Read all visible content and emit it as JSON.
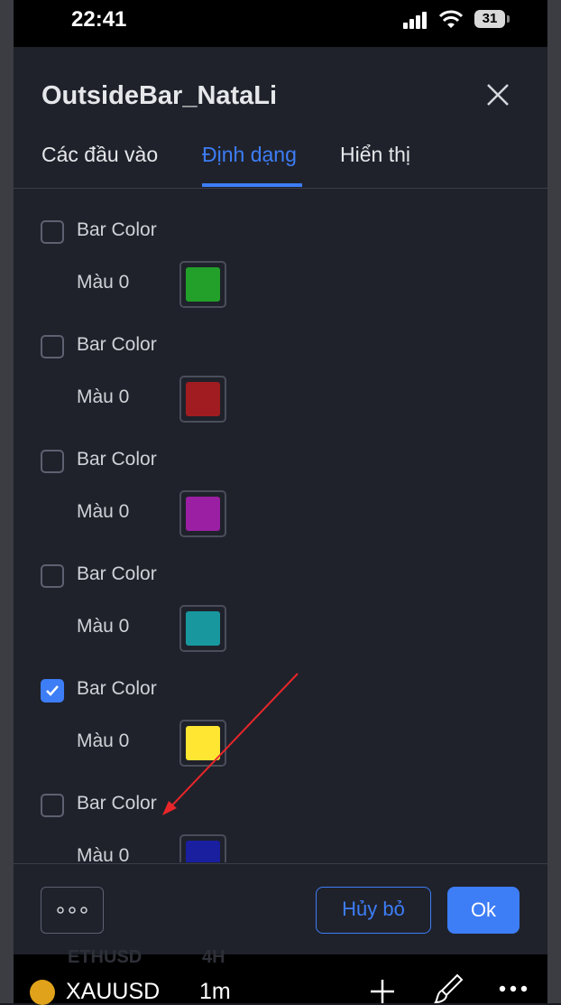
{
  "status_bar": {
    "time": "22:41",
    "battery": "31"
  },
  "dialog": {
    "title": "OutsideBar_NataLi",
    "tabs": [
      {
        "label": "Các đầu vào",
        "active": false
      },
      {
        "label": "Định dạng",
        "active": true
      },
      {
        "label": "Hiển thị",
        "active": false
      }
    ],
    "items": [
      {
        "checkbox_label": "Bar Color",
        "checked": false,
        "color_label": "Màu 0",
        "color": "#22a02a"
      },
      {
        "checkbox_label": "Bar Color",
        "checked": false,
        "color_label": "Màu 0",
        "color": "#a01c20"
      },
      {
        "checkbox_label": "Bar Color",
        "checked": false,
        "color_label": "Màu 0",
        "color": "#9a1fa3"
      },
      {
        "checkbox_label": "Bar Color",
        "checked": false,
        "color_label": "Màu 0",
        "color": "#18979e"
      },
      {
        "checkbox_label": "Bar Color",
        "checked": true,
        "color_label": "Màu 0",
        "color": "#ffe632"
      },
      {
        "checkbox_label": "Bar Color",
        "checked": false,
        "color_label": "Màu 0",
        "color": "#1a1fa0"
      }
    ],
    "footer": {
      "cancel_label": "Hủy bỏ",
      "ok_label": "Ok"
    }
  },
  "bottom_bar": {
    "symbol": "XAUUSD",
    "interval": "1m",
    "ghost_symbol": "ETHUSD",
    "ghost_interval": "4H"
  },
  "colors": {
    "accent": "#3d7df6",
    "dialog_bg": "#1f222b",
    "annotation_arrow": "#e8262a"
  },
  "icons": [
    "close-icon",
    "checkmark-icon",
    "more-icon",
    "coin-icon",
    "plus-icon",
    "brush-icon",
    "more-dots-icon"
  ]
}
